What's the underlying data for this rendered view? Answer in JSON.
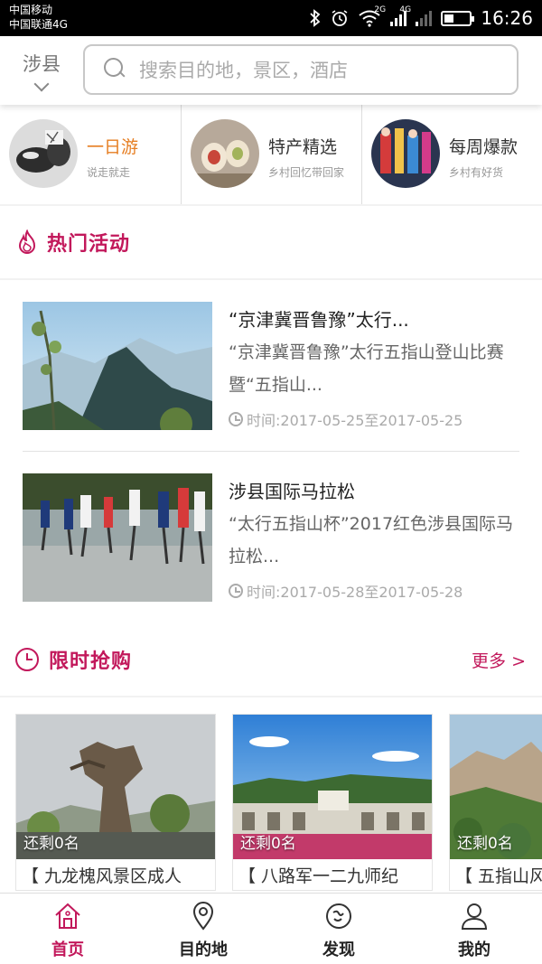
{
  "status": {
    "carrier1": "中国移动",
    "carrier2": "中国联通4G",
    "net1": "2G",
    "net2": "4G",
    "time": "16:26"
  },
  "header": {
    "city": "涉县",
    "search_placeholder": "搜索目的地，景区，酒店"
  },
  "categories": [
    {
      "title": "一日游",
      "subtitle": "说走就走",
      "color": "#e67e22",
      "icon": "tea-set-photo"
    },
    {
      "title": "特产精选",
      "subtitle": "乡村回忆带回家",
      "color": "#333333",
      "icon": "food-rolls-photo"
    },
    {
      "title": "每周爆款",
      "subtitle": "乡村有好货",
      "color": "#333333",
      "icon": "handicraft-photo"
    }
  ],
  "hot": {
    "title": "热门活动",
    "icon": "flame-icon",
    "events": [
      {
        "title": "“京津冀晋鲁豫”太行...",
        "desc": "“京津冀晋鲁豫”太行五指山登山比赛暨“五指山...",
        "time": "时间:2017-05-25至2017-05-25"
      },
      {
        "title": "涉县国际马拉松",
        "desc": "“太行五指山杯”2017红色涉县国际马拉松...",
        "time": "时间:2017-05-28至2017-05-28"
      }
    ]
  },
  "flash": {
    "title": "限时抢购",
    "icon": "clock-icon",
    "more": "更多 >",
    "items": [
      {
        "remain": "还剩0名",
        "title": "【 九龙槐风景区成人"
      },
      {
        "remain": "还剩0名",
        "title": "【 八路军一二九师纪"
      },
      {
        "remain": "还剩0名",
        "title": "【 五指山风"
      }
    ]
  },
  "tabs": [
    {
      "label": "首页",
      "icon": "home-icon",
      "active": true
    },
    {
      "label": "目的地",
      "icon": "location-pin-icon",
      "active": false
    },
    {
      "label": "发现",
      "icon": "compass-icon",
      "active": false
    },
    {
      "label": "我的",
      "icon": "user-icon",
      "active": false
    }
  ],
  "colors": {
    "accent": "#c2185b",
    "orange": "#e67e22"
  }
}
